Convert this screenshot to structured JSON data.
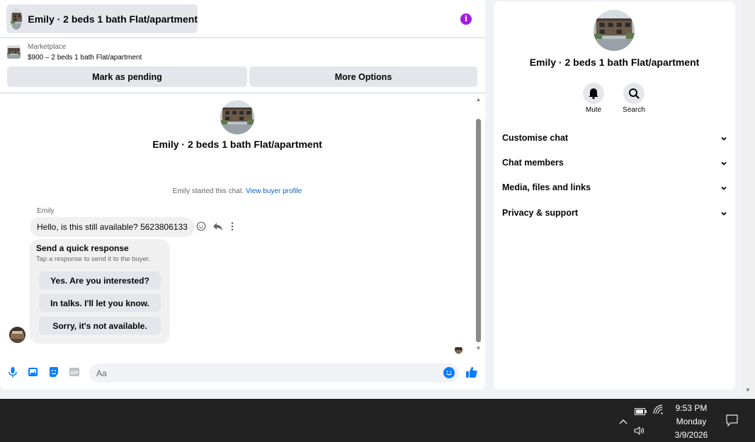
{
  "header": {
    "title": "Emily · 2 beds 1 bath Flat/apartment",
    "info_icon": "info-icon"
  },
  "listing": {
    "source": "Marketplace",
    "price_line": "$900 – 2 beds 1 bath Flat/apartment"
  },
  "actions": {
    "mark_pending": "Mark as pending",
    "more_options": "More Options"
  },
  "conversation": {
    "title": "Emily · 2 beds 1 bath Flat/apartment",
    "started_text": "Emily started this chat.",
    "view_buyer_profile": "View buyer profile",
    "sender_name": "Emily",
    "message": "Hello, is this still available? 5623806133",
    "quick_response": {
      "title": "Send a quick response",
      "subtitle": "Tap a response to send it to the buyer.",
      "options": [
        "Yes. Are you interested?",
        "In talks. I'll let you know.",
        "Sorry, it's not available."
      ]
    }
  },
  "composer": {
    "placeholder": "Aa",
    "icons": [
      "microphone-icon",
      "photo-icon",
      "sticker-icon",
      "gif-icon",
      "emoji-icon",
      "thumbs-up-icon"
    ]
  },
  "info_panel": {
    "title": "Emily · 2 beds 1 bath Flat/apartment",
    "mute_label": "Mute",
    "search_label": "Search",
    "sections": [
      "Customise chat",
      "Chat members",
      "Media, files and links",
      "Privacy & support"
    ]
  },
  "taskbar": {
    "time": "9:53 PM",
    "day": "Monday",
    "date": "3/9/2026"
  },
  "colors": {
    "accent_blue": "#0a7cff",
    "link_blue": "#0064d1",
    "info_purple": "#a31be2",
    "button_grey": "#e4e6eb",
    "taskbar": "#222222"
  }
}
